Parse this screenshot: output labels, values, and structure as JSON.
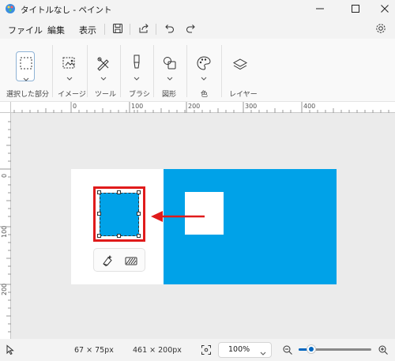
{
  "window": {
    "title": "タイトルなし - ペイント"
  },
  "menu": {
    "file": "ファイル",
    "edit": "編集",
    "view": "表示"
  },
  "ribbon": {
    "groups": {
      "selection": "選択した部分",
      "image": "イメージ",
      "tools": "ツール",
      "brushes": "ブラシ",
      "shapes": "図形",
      "colors": "色",
      "layers": "レイヤー"
    }
  },
  "ruler": {
    "top": [
      "0",
      "100",
      "200",
      "300",
      "400"
    ],
    "left": [
      "0",
      "100",
      "200"
    ]
  },
  "status": {
    "selection_size": "67 × 75px",
    "canvas_size": "461 × 200px",
    "zoom": "100%"
  },
  "colors": {
    "fill": "#00a2e8",
    "highlight": "#e01b1b",
    "accent": "#0067c0"
  }
}
